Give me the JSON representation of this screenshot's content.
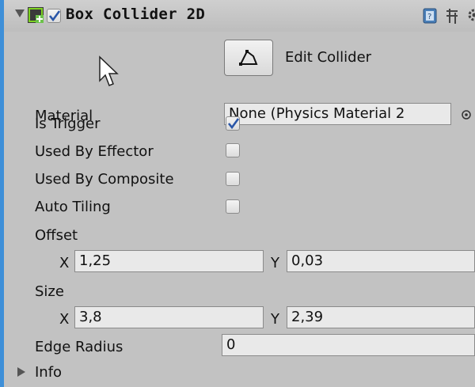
{
  "component": {
    "title": "Box Collider 2D",
    "enabled": true,
    "icons": [
      "component-add-icon",
      "book-icon",
      "preset-icon",
      "gear-icon"
    ]
  },
  "edit_collider": {
    "label": "Edit Collider",
    "icon": "polygon-edit-icon"
  },
  "material": {
    "label": "Material",
    "value": "None (Physics Material 2"
  },
  "is_trigger": {
    "label": "Is Trigger",
    "checked": true
  },
  "used_by_effector": {
    "label": "Used By Effector",
    "checked": false
  },
  "used_by_composite": {
    "label": "Used By Composite",
    "checked": false
  },
  "auto_tiling": {
    "label": "Auto Tiling",
    "checked": false
  },
  "offset": {
    "label": "Offset",
    "x_label": "X",
    "x": "1,25",
    "y_label": "Y",
    "y": "0,03"
  },
  "size": {
    "label": "Size",
    "x_label": "X",
    "x": "3,8",
    "y_label": "Y",
    "y": "2,39"
  },
  "edge_radius": {
    "label": "Edge Radius",
    "value": "0"
  },
  "info": {
    "label": "Info"
  },
  "colors": {
    "accent": "#3e8fd8",
    "panel": "#c2c2c2",
    "field": "#e9e9e9",
    "check": "#2a56a8"
  }
}
